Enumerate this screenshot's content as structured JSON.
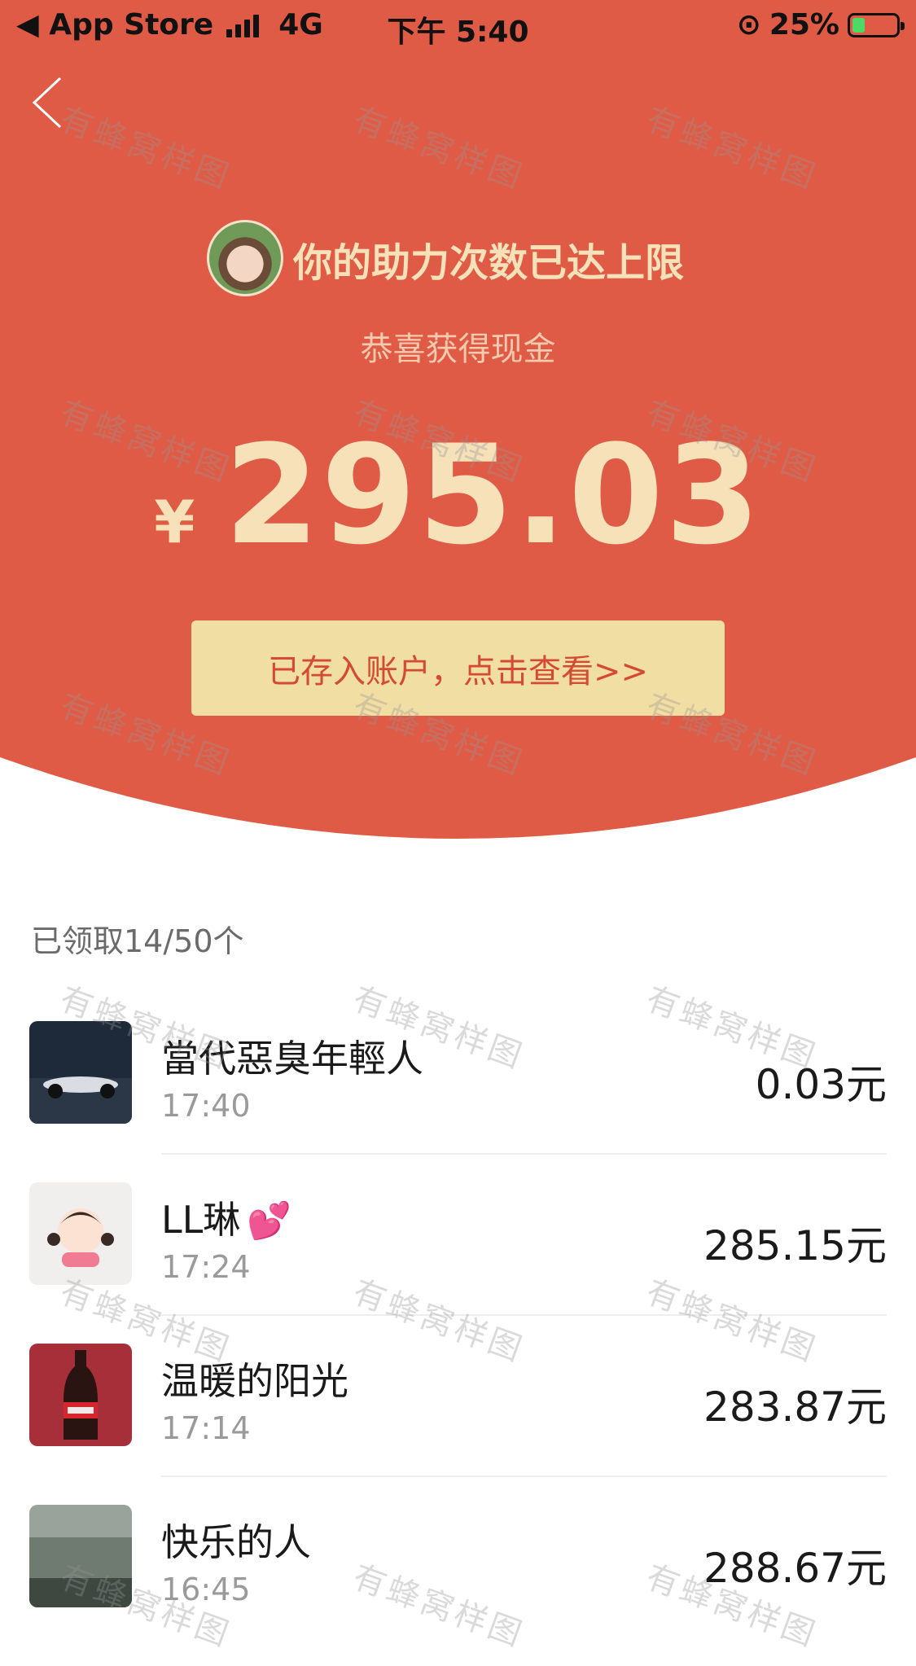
{
  "status_bar": {
    "carrier_back": "◀ App Store",
    "network": "4G",
    "time": "下午 5:40",
    "battery_percent": "25%"
  },
  "hero": {
    "title": "你的助力次数已达上限",
    "subtitle": "恭喜获得现金",
    "currency_symbol": "¥",
    "amount": "295.03",
    "cta_label": "已存入账户，点击查看>>",
    "theme_color": "#e05b45",
    "gold_color": "#f6e1b8"
  },
  "list": {
    "header": "已领取14/50个",
    "rows": [
      {
        "name": "當代惡臭年輕人",
        "time": "17:40",
        "amount": "0.03元",
        "avatar": "race-car-avatar"
      },
      {
        "name": "LL琳",
        "emoji": "💕",
        "time": "17:24",
        "amount": "285.15元",
        "avatar": "girl-cartoon-avatar"
      },
      {
        "name": "温暖的阳光",
        "time": "17:14",
        "amount": "283.87元",
        "avatar": "cola-bottle-avatar"
      },
      {
        "name": "快乐的人",
        "time": "16:45",
        "amount": "288.67元",
        "avatar": "sea-landscape-avatar"
      }
    ]
  },
  "watermark_text": "有蜂窝样图"
}
